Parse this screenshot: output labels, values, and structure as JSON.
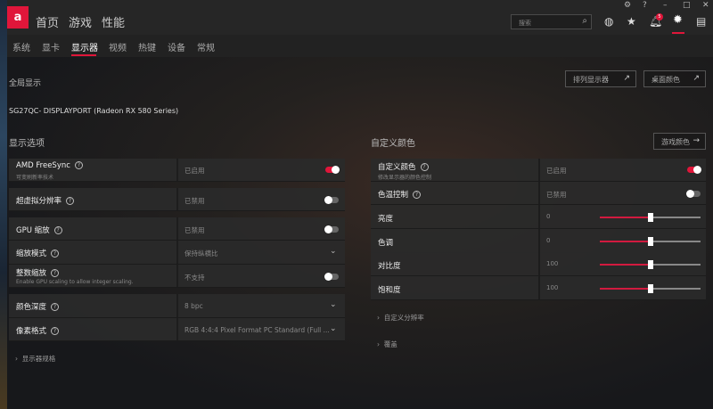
{
  "titlebar": {
    "icons": [
      "bug-icon",
      "help-icon",
      "minimize-icon",
      "maximize-icon",
      "close-icon"
    ]
  },
  "nav": {
    "logo": "a",
    "items": [
      "首页",
      "游戏",
      "性能"
    ],
    "search_placeholder": "搜索",
    "notification_count": "5"
  },
  "subnav": {
    "items": [
      "系统",
      "显卡",
      "显示器",
      "视频",
      "热键",
      "设备",
      "常规"
    ],
    "active": "显示器"
  },
  "global": {
    "title": "全局显示",
    "arrange_button": "排列显示器",
    "desktop_color_button": "桌面颜色",
    "monitor": "SG27QC- DISPLAYPORT (Radeon RX 580 Series)"
  },
  "display_options": {
    "title": "显示选项",
    "freesync": {
      "label": "AMD FreeSync",
      "sub": "可变刷新率技术",
      "value": "已启用",
      "on": true
    },
    "vsr": {
      "label": "超虚拟分辨率",
      "value": "已禁用",
      "on": false
    },
    "gpu_scaling": {
      "label": "GPU 缩放",
      "value": "已禁用",
      "on": false
    },
    "scaling_mode": {
      "label": "缩放模式",
      "value": "保持纵横比"
    },
    "integer_scaling": {
      "label": "整数缩放",
      "sub": "Enable GPU scaling to allow integer scaling.",
      "value": "不支持",
      "on": false
    },
    "color_depth": {
      "label": "颜色深度",
      "value": "8 bpc"
    },
    "pixel_format": {
      "label": "像素格式",
      "value": "RGB 4:4:4 Pixel Format PC Standard (Full ..."
    },
    "specs": "显示器规格"
  },
  "custom_color": {
    "title": "自定义颜色",
    "game_color_button": "游戏颜色",
    "enable": {
      "label": "自定义颜色",
      "sub": "修改显示器的颜色控制",
      "value": "已启用",
      "on": true
    },
    "temp": {
      "label": "色温控制",
      "value": "已禁用",
      "on": false
    },
    "sliders": [
      {
        "label": "亮度",
        "value": "0",
        "percent": 50
      },
      {
        "label": "色调",
        "value": "0",
        "percent": 50
      },
      {
        "label": "对比度",
        "value": "100",
        "percent": 50
      },
      {
        "label": "饱和度",
        "value": "100",
        "percent": 50
      }
    ],
    "custom_resolution": "自定义分辨率",
    "override": "覆盖"
  },
  "colors": {
    "accent": "#e0163a"
  }
}
